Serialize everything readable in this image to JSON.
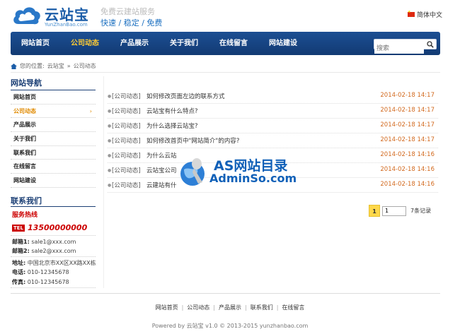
{
  "header": {
    "brand": "云站宝",
    "brand_sub": "YunZhanBao.com",
    "tagline": "免费云建站服务",
    "slogan": "快速 / 稳定 / 免费",
    "language": "简体中文"
  },
  "nav": {
    "items": [
      "网站首页",
      "公司动态",
      "产品展示",
      "关于我们",
      "在线留言",
      "网站建设"
    ],
    "active": "公司动态",
    "search_placeholder": "搜索"
  },
  "breadcrumb": {
    "prefix": "您的位置:",
    "home": "云站宝",
    "sep": "»",
    "current": "公司动态"
  },
  "sidebar": {
    "title": "网站导航",
    "items": [
      "网站首页",
      "公司动态",
      "产品展示",
      "关于我们",
      "联系我们",
      "在线留言",
      "网站建设"
    ],
    "active_arrow": "›",
    "contact_title": "联系我们",
    "hotline_label": "服务热线",
    "tel_badge": "TEL",
    "tel": "13500000000",
    "email1_label": "邮箱1:",
    "email1": "sale1@xxx.com",
    "email2_label": "邮箱2:",
    "email2": "sale2@xxx.com",
    "address_label": "地址:",
    "address": "中国北京市XX区XX路XX栋",
    "phone_label": "电话:",
    "phone": "010-12345678",
    "fax_label": "传真:",
    "fax": "010-12345678"
  },
  "articles": [
    {
      "cat": "[公司动态]",
      "title": "如何修改页面左边的联系方式",
      "date": "2014-02-18 14:17"
    },
    {
      "cat": "[公司动态]",
      "title": "云站宝有什么特点?",
      "date": "2014-02-18 14:17"
    },
    {
      "cat": "[公司动态]",
      "title": "为什么选择云站宝?",
      "date": "2014-02-18 14:17"
    },
    {
      "cat": "[公司动态]",
      "title": "如何修改首页中\"网站简介\"的内容?",
      "date": "2014-02-18 14:17"
    },
    {
      "cat": "[公司动态]",
      "title": "为什么云站",
      "date": "2014-02-18 14:16"
    },
    {
      "cat": "[公司动态]",
      "title": "云站宝公司",
      "date": "2014-02-18 14:16"
    },
    {
      "cat": "[公司动态]",
      "title": "云建站有什",
      "date": "2014-02-18 14:16"
    }
  ],
  "pager": {
    "current": "1",
    "input_value": "1",
    "total": "7条记录"
  },
  "watermark": {
    "line1": "AS网站目录",
    "line2": "AdminSo.com"
  },
  "footer": {
    "links": [
      "网站首页",
      "公司动态",
      "产品展示",
      "联系我们",
      "在线留言"
    ],
    "copyright": "Powered by 云站宝 v1.0 © 2013-2015 yunzhanbao.com"
  },
  "colors": {
    "nav_bg": "#1c4f93",
    "nav_active": "#ffcc33",
    "date": "#d2691e",
    "hotline": "#cc0000",
    "pager_current": "#ffd84a"
  }
}
